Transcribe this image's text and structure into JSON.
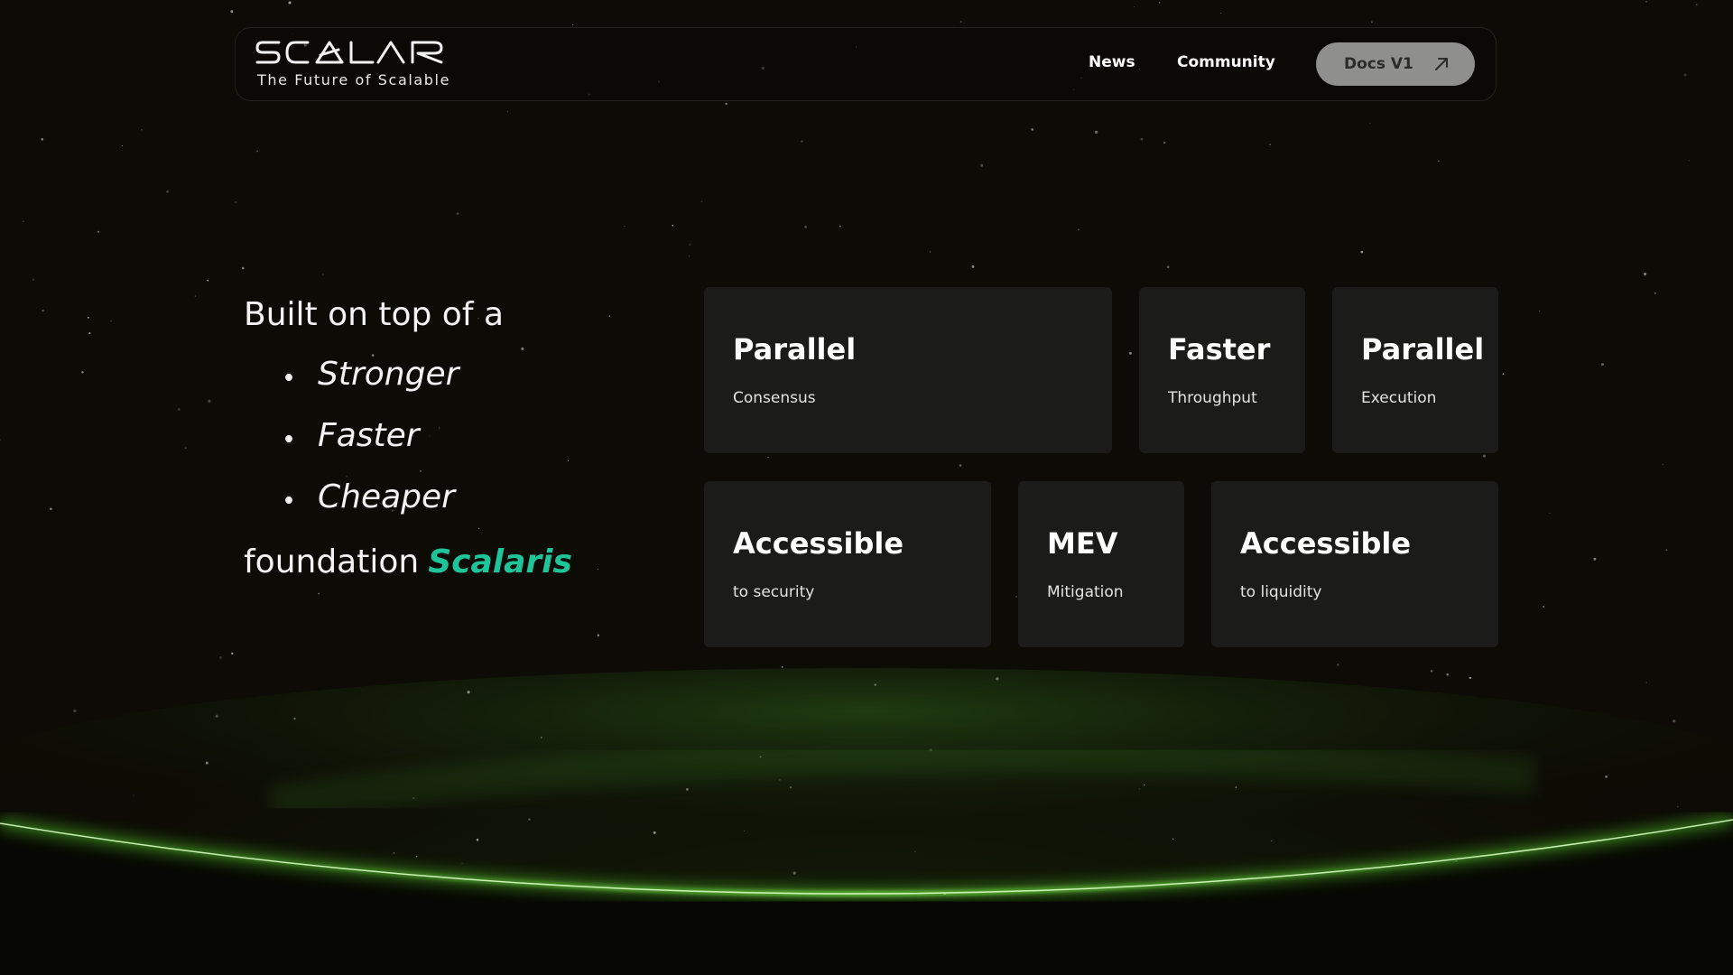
{
  "brand": {
    "name": "SCALAR",
    "tagline": "The Future of Scalable"
  },
  "nav": {
    "links": [
      "News",
      "Community"
    ],
    "docs_button": {
      "label": "Docs V1",
      "icon": "arrow-up-right-icon"
    }
  },
  "intro": {
    "lead": "Built on top of a",
    "bullets": [
      "Stronger",
      "Faster",
      "Cheaper"
    ],
    "closing_prefix": "foundation",
    "closing_highlight": "Scalaris"
  },
  "features": [
    {
      "title": "Parallel",
      "subtitle": "Consensus"
    },
    {
      "title": "Faster",
      "subtitle": "Throughput"
    },
    {
      "title": "Parallel",
      "subtitle": "Execution"
    },
    {
      "title": "Accessible",
      "subtitle": "to security"
    },
    {
      "title": "MEV",
      "subtitle": "Mitigation"
    },
    {
      "title": "Accessible",
      "subtitle": "to liquidity"
    }
  ],
  "colors": {
    "background": "#0c0b05",
    "accent": "#1ec59b",
    "card": "#1b1b1a",
    "button": "#8f8f8d",
    "horizon_glow": "#6cff3a"
  }
}
